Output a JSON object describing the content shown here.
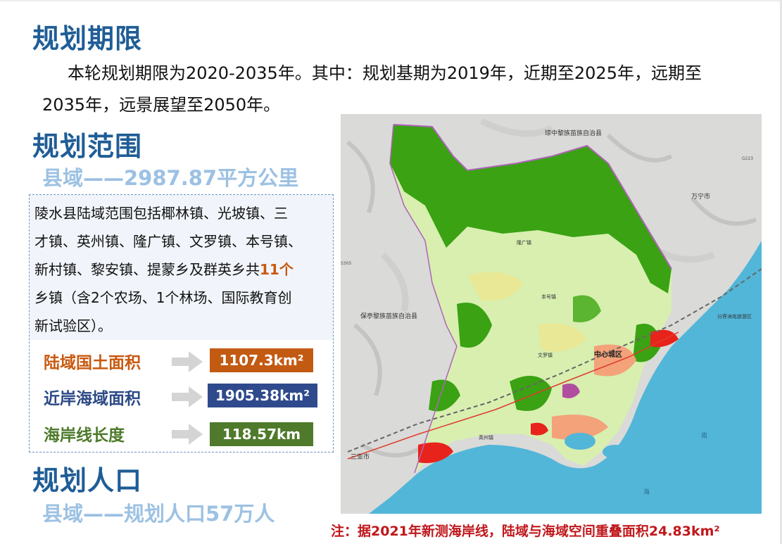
{
  "period": {
    "heading": "规划期限",
    "line1": "本轮规划期限为2020-2035年。其中：规划基期为2019年，近期至2025年，远期至",
    "line2": "2035年，远景展望至2050年。"
  },
  "scope": {
    "heading": "规划范围",
    "subheading": "县域——2987.87平方公里",
    "lines": [
      "陵水县陆域范围包括椰林镇、光坡镇、三",
      "才镇、英州镇、隆广镇、文罗镇、本号镇、",
      "新村镇、黎安镇、提蒙乡及群英乡共",
      "乡镇（含2个农场、1个林场、国际教育创",
      "新试验区）。"
    ],
    "highlight": "11个",
    "stats": [
      {
        "label": "陆域国土面积",
        "value": "1107.3km²",
        "label_color": "#c9590f",
        "box_color": "#c35a12"
      },
      {
        "label": "近岸海域面积",
        "value": "1905.38km²",
        "label_color": "#2d4a87",
        "box_color": "#2f4a8c"
      },
      {
        "label": "海岸线长度",
        "value": "118.57km",
        "label_color": "#4d7a2a",
        "box_color": "#4f7a2c"
      }
    ]
  },
  "population": {
    "heading": "规划人口",
    "subheading": "县域——规划人口57万人"
  },
  "note": "注：据2021年新测海岸线，陆域与海域空间重叠面积24.83km²",
  "map": {
    "labels": {
      "qiongzhong": "琼中黎族苗族自治县",
      "wanning": "万宁市",
      "baoting": "保亭黎族苗族自治县",
      "sanya": "三亚市",
      "center": "中心城区",
      "benhao": "本号镇",
      "longguang": "隆广镇",
      "wenluo": "文罗镇",
      "yingzhou": "英州镇",
      "sea1": "南",
      "sea2": "海",
      "island": "分界洲岛旅游区",
      "road1": "G223",
      "road2": "S305"
    },
    "colors": {
      "forest": "#3aa213",
      "farmland": "#d8efb0",
      "sea": "#52b6d8",
      "urban": "#f4a27a",
      "construction": "#e8231b"
    }
  }
}
